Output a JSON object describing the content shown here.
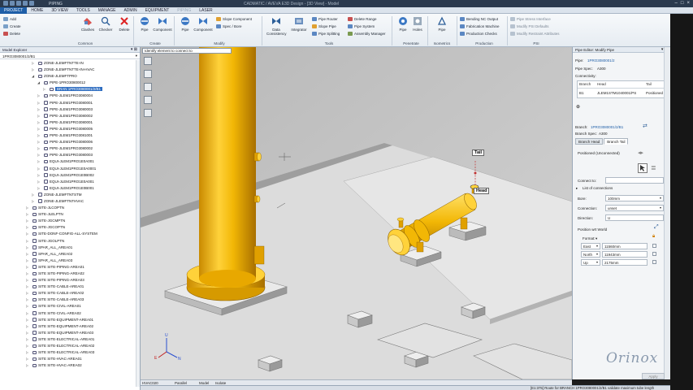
{
  "titlebar": {
    "app_title": "PIPING",
    "window_title": "CADMATIC / AVEVA E3D Design - [3D View] - Model"
  },
  "tabs": [
    "PROJECT",
    "HOME",
    "3D VIEW",
    "TOOLS",
    "MANAGE",
    "ADMIN",
    "EQUIPMENT",
    "PIPING",
    "LASER"
  ],
  "ribbon": {
    "common": {
      "label": "Common",
      "buttons": [
        "Clashes",
        "Checker",
        "Delete"
      ],
      "small": [
        "Add",
        "Create",
        "Delete"
      ]
    },
    "create": {
      "label": "Create",
      "buttons": [
        "Pipe",
        "Component"
      ]
    },
    "modify": {
      "label": "Modify",
      "buttons": [
        "Pipe",
        "Component"
      ],
      "small": [
        "Slope Component",
        "Spec / Bore"
      ]
    },
    "tools": {
      "label": "Tools",
      "buttons": [
        "Data Consistency",
        "Integrator"
      ],
      "small": [
        "Pipe Router",
        "Slope Pipe",
        "Pipe Splitting",
        "Delete Range",
        "Pipe System",
        "Assembly Manager"
      ]
    },
    "penetrate": {
      "label": "Penetrate",
      "buttons": [
        "Pipe",
        "Holes"
      ]
    },
    "isometrics": {
      "label": "Isometrics",
      "buttons": [
        "Pipe"
      ]
    },
    "production": {
      "label": "Production",
      "small": [
        "Bending NC Output",
        "Fabrication Machine",
        "Production Checks"
      ]
    },
    "psi": {
      "label": "PSI",
      "small": [
        "Pipe Stress Interface",
        "Modify PSI Defaults",
        "Modify Restraint Attributes"
      ]
    }
  },
  "explorer": {
    "title": "Model Explorer",
    "path": "1PRO3080001/2/B1",
    "items": [
      {
        "label": "ZONE-JLEMFTNTTE-IN",
        "level": 3,
        "expanded": false
      },
      {
        "label": "ZONE-JLEMFTNTTE-IN-HVAC",
        "level": 3,
        "expanded": false
      },
      {
        "label": "ZONE-JLEMFTPRO",
        "level": 3,
        "expanded": true
      },
      {
        "label": "PIPE-1PRO30800012",
        "level": 4,
        "expanded": true
      },
      {
        "label": "BRAN 1PRO3080001/2/B1",
        "level": 5,
        "expanded": false,
        "selected": true
      },
      {
        "label": "PIPE-JLEM1PRO3080004",
        "level": 4,
        "expanded": false
      },
      {
        "label": "PIPE-JLEM1PRO3080001",
        "level": 4,
        "expanded": false
      },
      {
        "label": "PIPE-JLEM1PRO3080003",
        "level": 4,
        "expanded": false
      },
      {
        "label": "PIPE-JLEM1PRO3080002",
        "level": 4,
        "expanded": false
      },
      {
        "label": "PIPE-JLEM1PRO3080001",
        "level": 4,
        "expanded": false
      },
      {
        "label": "PIPE-JLEM1PRO3080005",
        "level": 4,
        "expanded": false
      },
      {
        "label": "PIPE-JLEM1PRO3081001",
        "level": 4,
        "expanded": false
      },
      {
        "label": "PIPE-JLEM1PRO3080006",
        "level": 4,
        "expanded": false
      },
      {
        "label": "PIPE-JLEM1PRO3080002",
        "level": 4,
        "expanded": false
      },
      {
        "label": "PIPE-JLEM1PRO3080003",
        "level": 4,
        "expanded": false
      },
      {
        "label": "EQUI-JLEM1PRO1E0A001",
        "level": 4,
        "expanded": false
      },
      {
        "label": "EQUI-JLEM1PRO1E0A0001",
        "level": 4,
        "expanded": false
      },
      {
        "label": "EQUI-JLEM1PRO1E0B002",
        "level": 4,
        "expanded": false
      },
      {
        "label": "EQUI-JLEM1PRO1E0A001",
        "level": 4,
        "expanded": false
      },
      {
        "label": "EQUI-JLEM1PRO1E0B001",
        "level": 4,
        "expanded": false
      },
      {
        "label": "ZONE-JLEMFTNTSTM",
        "level": 3,
        "expanded": false
      },
      {
        "label": "ZONE-JLEMFTNTHVAC",
        "level": 3,
        "expanded": false
      },
      {
        "label": "SITE-JLCOPTN",
        "level": 2,
        "expanded": false
      },
      {
        "label": "SITE-JLELPTN",
        "level": 2,
        "expanded": false
      },
      {
        "label": "SITE-JGCMPTN",
        "level": 2,
        "expanded": false
      },
      {
        "label": "SITE-JGCOPTN",
        "level": 2,
        "expanded": false
      },
      {
        "label": "SITE-DONF-CONFIG-ALL-SYSTEM",
        "level": 2,
        "expanded": false
      },
      {
        "label": "SITE-JGOLPTN",
        "level": 2,
        "expanded": false
      },
      {
        "label": "SPAR_ALL_AREA01",
        "level": 2,
        "expanded": false
      },
      {
        "label": "SPAR_ALL_AREA02",
        "level": 2,
        "expanded": false
      },
      {
        "label": "SPAR_ALL_AREA03",
        "level": 2,
        "expanded": false
      },
      {
        "label": "SITE SITE-PIPING-AREA01",
        "level": 2,
        "expanded": false
      },
      {
        "label": "SITE SITE-PIPING-AREA02",
        "level": 2,
        "expanded": false
      },
      {
        "label": "SITE SITE-PIPING-AREA03",
        "level": 2,
        "expanded": false
      },
      {
        "label": "SITE SITE-CABLE-AREA01",
        "level": 2,
        "expanded": false
      },
      {
        "label": "SITE SITE-CABLE-AREA02",
        "level": 2,
        "expanded": false
      },
      {
        "label": "SITE SITE-CABLE-AREA03",
        "level": 2,
        "expanded": false
      },
      {
        "label": "SITE SITE-CIVIL-AREA01",
        "level": 2,
        "expanded": false
      },
      {
        "label": "SITE SITE-CIVIL-AREA02",
        "level": 2,
        "expanded": false
      },
      {
        "label": "SITE SITE-EQUIPMENT-AREA01",
        "level": 2,
        "expanded": false
      },
      {
        "label": "SITE SITE-EQUIPMENT-AREA02",
        "level": 2,
        "expanded": false
      },
      {
        "label": "SITE SITE-EQUIPMENT-AREA03",
        "level": 2,
        "expanded": false
      },
      {
        "label": "SITE SITE-ELECTRICAL-AREA01",
        "level": 2,
        "expanded": false
      },
      {
        "label": "SITE SITE-ELECTRICAL-AREA02",
        "level": 2,
        "expanded": false
      },
      {
        "label": "SITE SITE-ELECTRICAL-AREA03",
        "level": 2,
        "expanded": false
      },
      {
        "label": "SITE SITE-HVAC-AREA01",
        "level": 2,
        "expanded": false
      },
      {
        "label": "SITE SITE-HVAC-AREA02",
        "level": 2,
        "expanded": false
      }
    ]
  },
  "viewport": {
    "hint": "Identify element to connect to",
    "callouts": {
      "tail": "Tail",
      "head": "Head"
    },
    "status": [
      "HVAC020",
      "Parallel",
      "Model",
      "Isolate"
    ]
  },
  "editor": {
    "title": "Pipe Editor: Modify Pipe",
    "pipe_label": "Pipe:",
    "pipe_value": "1PRO3080001/2",
    "pipe_spec_label": "Pipe Spec:",
    "pipe_spec_value": "A300",
    "connectivity_label": "Connectivity:",
    "table_headers": [
      "Branch",
      "Head",
      "Tail"
    ],
    "table_row": [
      "B1",
      "JLEM1STM1040001/PS",
      "Positioned"
    ],
    "branch_label": "Branch:",
    "branch_value": "1PRO3080001/2/B1",
    "branch_spec_label": "Branch Spec:",
    "branch_spec_value": "A300",
    "tabs": [
      "Branch Head",
      "Branch Tail"
    ],
    "positioned": "Positioned (Unconnected)",
    "connect_to_label": "Connect to:",
    "list_of_connections": "List of connections",
    "bore_label": "Bore:",
    "bore_value": "100mm",
    "connection_label": "Connection:",
    "connection_value": "unset",
    "direction_label": "Direction:",
    "direction_value": "U",
    "position_label": "Position wrt World",
    "format_label": "Format:",
    "coords": [
      {
        "axis": "East",
        "value": "11560mm"
      },
      {
        "axis": "North",
        "value": "11943mm"
      },
      {
        "axis": "Up",
        "value": "2175mm"
      }
    ],
    "apply": "Apply"
  },
  "bottom_status": "[E1:375] Route for BRANCH 1PRO3080001/2/B1 validate maximum tube length",
  "brand": "Orinox",
  "colors": {
    "accent": "#1f5fa8",
    "pipe_yellow": "#f2b705",
    "ground": "#cfcfcf"
  }
}
